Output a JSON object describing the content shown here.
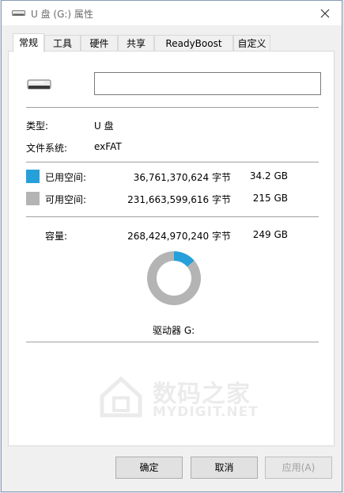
{
  "window": {
    "title": "U 盘 (G:) 属性"
  },
  "tabs": [
    {
      "label": "常规",
      "active": true
    },
    {
      "label": "工具"
    },
    {
      "label": "硬件"
    },
    {
      "label": "共享"
    },
    {
      "label": "ReadyBoost"
    },
    {
      "label": "自定义"
    }
  ],
  "general": {
    "volume_name": "",
    "type_label": "类型:",
    "type_value": "U 盘",
    "fs_label": "文件系统:",
    "fs_value": "exFAT",
    "used": {
      "label": "已用空间:",
      "bytes": "36,761,370,624 字节",
      "size": "34.2 GB",
      "color": "#26a0da"
    },
    "free": {
      "label": "可用空间:",
      "bytes": "231,663,599,616 字节",
      "size": "215 GB",
      "color": "#b4b4b4"
    },
    "capacity": {
      "label": "容量:",
      "bytes": "268,424,970,240 字节",
      "size": "249 GB"
    },
    "drive_label": "驱动器 G:"
  },
  "chart_data": {
    "type": "pie",
    "categories": [
      "已用空间",
      "可用空间"
    ],
    "values": [
      34.2,
      215
    ],
    "colors": [
      "#26a0da",
      "#b4b4b4"
    ]
  },
  "watermark": {
    "title": "数码之家",
    "subtitle": "MYDIGIT.NET"
  },
  "buttons": {
    "ok": "确定",
    "cancel": "取消",
    "apply": "应用(A)"
  }
}
